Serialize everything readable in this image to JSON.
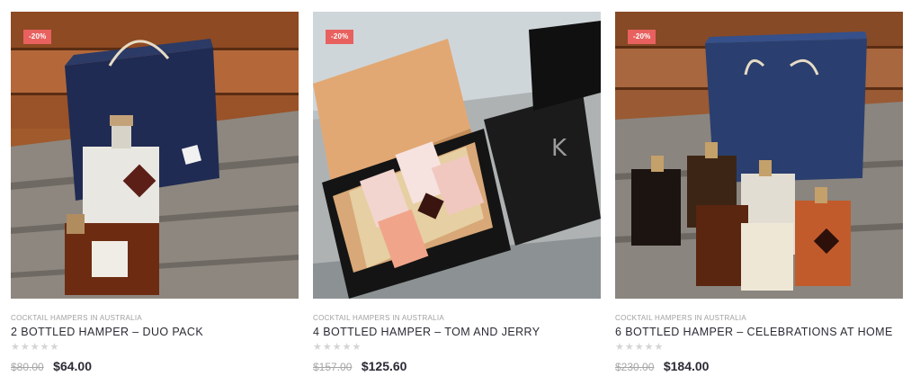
{
  "products": [
    {
      "badge": "-20%",
      "category": "COCKTAIL HAMPERS IN AUSTRALIA",
      "title": "2 BOTTLED HAMPER – DUO PACK",
      "rating": 0,
      "stars": "★★★★★",
      "old_price": "$80.00",
      "new_price": "$64.00",
      "image_icon": "product-photo-duo-pack"
    },
    {
      "badge": "-20%",
      "category": "COCKTAIL HAMPERS IN AUSTRALIA",
      "title": "4 BOTTLED HAMPER – TOM AND JERRY",
      "rating": 0,
      "stars": "★★★★★",
      "old_price": "$157.00",
      "new_price": "$125.60",
      "image_icon": "product-photo-tom-and-jerry"
    },
    {
      "badge": "-20%",
      "category": "COCKTAIL HAMPERS IN AUSTRALIA",
      "title": "6 BOTTLED HAMPER – CELEBRATIONS AT HOME",
      "rating": 0,
      "stars": "★★★★★",
      "old_price": "$230.00",
      "new_price": "$184.00",
      "image_icon": "product-photo-celebrations-at-home"
    }
  ],
  "colors": {
    "badge": "#e8615f",
    "title": "#2b2b35",
    "category": "#a0a0a0",
    "old_price": "#a6a6a6",
    "star_empty": "#d4d4d4"
  }
}
